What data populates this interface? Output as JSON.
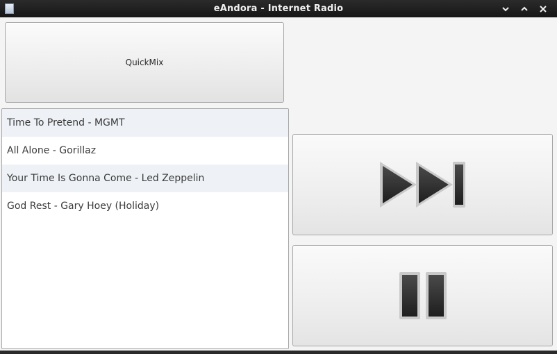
{
  "window": {
    "title": "eAndora - Internet Radio"
  },
  "titlebar": {
    "icons": [
      "app-icon",
      "minimize-icon",
      "maximize-icon",
      "close-icon"
    ]
  },
  "quickmix": {
    "label": "QuickMix"
  },
  "playlist": {
    "songs": [
      "Time To Pretend - MGMT",
      "All Alone - Gorillaz",
      "Your Time Is Gonna Come - Led Zeppelin",
      "God Rest - Gary Hoey (Holiday)"
    ]
  },
  "controls": {
    "skip_icon": "skip-forward-icon",
    "pause_icon": "pause-icon"
  },
  "colors": {
    "titlebar": "#1c1c1c",
    "window_bg": "#f4f4f4",
    "row_alt": "#eef2f6",
    "icon_dark": "#2e2e2e"
  }
}
